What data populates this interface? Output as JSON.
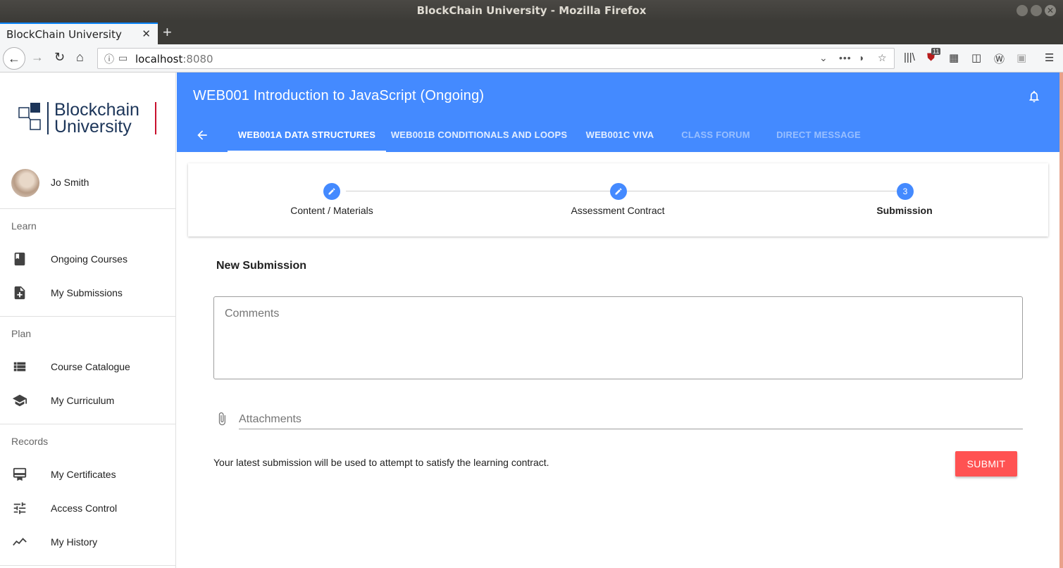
{
  "window": {
    "title": "BlockChain University - Mozilla Firefox"
  },
  "browser": {
    "tab_title": "BlockChain University",
    "url_host": "localhost",
    "url_port": ":8080",
    "badge_count": "11"
  },
  "sidebar": {
    "logo_line1": "Blockchain",
    "logo_line2": "University",
    "user_name": "Jo Smith",
    "sections": {
      "learn": "Learn",
      "plan": "Plan",
      "records": "Records"
    },
    "items": [
      {
        "label": "Ongoing Courses",
        "icon": "book-icon"
      },
      {
        "label": "My Submissions",
        "icon": "note-add-icon"
      },
      {
        "label": "Course Catalogue",
        "icon": "list-icon"
      },
      {
        "label": "My Curriculum",
        "icon": "school-icon"
      },
      {
        "label": "My Certificates",
        "icon": "certificate-icon"
      },
      {
        "label": "Access Control",
        "icon": "tune-icon"
      },
      {
        "label": "My History",
        "icon": "timeline-icon"
      }
    ]
  },
  "header": {
    "title": "WEB001 Introduction to JavaScript (Ongoing)",
    "tabs": [
      {
        "label": "WEB001A DATA STRUCTURES",
        "state": "active"
      },
      {
        "label": "WEB001B CONDITIONALS AND LOOPS",
        "state": "normal"
      },
      {
        "label": "WEB001C VIVA",
        "state": "normal"
      },
      {
        "label": "CLASS FORUM",
        "state": "disabled"
      },
      {
        "label": "DIRECT MESSAGE",
        "state": "disabled"
      }
    ]
  },
  "stepper": {
    "steps": [
      {
        "label": "Content / Materials",
        "marker": "edit-icon"
      },
      {
        "label": "Assessment Contract",
        "marker": "edit-icon"
      },
      {
        "label": "Submission",
        "number": "3"
      }
    ]
  },
  "submission": {
    "title": "New Submission",
    "comments_placeholder": "Comments",
    "attachments_placeholder": "Attachments",
    "note": "Your latest submission will be used to attempt to satisfy the learning contract.",
    "submit_label": "SUBMIT"
  },
  "colors": {
    "primary": "#448aff",
    "accent": "#ff5252",
    "logo_navy": "#1c3559",
    "logo_red": "#c8102e"
  }
}
